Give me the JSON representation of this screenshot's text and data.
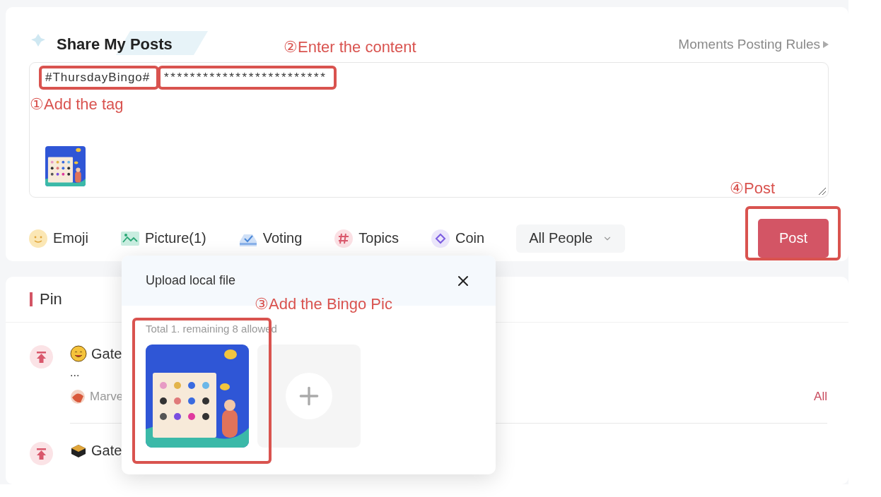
{
  "header": {
    "title": "Share My Posts",
    "rules_link": "Moments Posting Rules"
  },
  "editor": {
    "tag": "#ThursdayBingo#",
    "content": "*************************"
  },
  "toolbar": [
    {
      "kind": "emoji",
      "label": "Emoji"
    },
    {
      "kind": "picture",
      "label": "Picture(1)"
    },
    {
      "kind": "voting",
      "label": "Voting"
    },
    {
      "kind": "topics",
      "label": "Topics"
    },
    {
      "kind": "coin",
      "label": "Coin"
    }
  ],
  "audience": {
    "value": "All People"
  },
  "post_button": "Post",
  "upload_popup": {
    "title": "Upload local file",
    "hint": "Total 1. remaining 8 allowed"
  },
  "pin_section": {
    "title": "Pin",
    "items": [
      {
        "kind": "smile",
        "title": "Gate",
        "excerpt": "...",
        "author": "Marve",
        "action": "All"
      },
      {
        "kind": "box",
        "title": "Gate"
      }
    ]
  },
  "annotations": [
    {
      "kind": "tag",
      "label": "①Add the tag"
    },
    {
      "kind": "content",
      "label": "②Enter the content"
    },
    {
      "kind": "picture",
      "label": "③Add the Bingo Pic"
    },
    {
      "kind": "post",
      "label": "④Post"
    }
  ]
}
